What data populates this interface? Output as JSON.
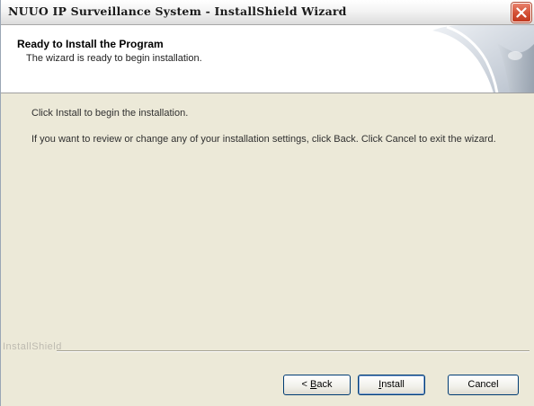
{
  "window": {
    "title": "NUUO IP Surveillance System - InstallShield Wizard"
  },
  "header": {
    "title": "Ready to Install the Program",
    "subtitle": "The wizard is ready to begin installation."
  },
  "body": {
    "line1": "Click Install to begin the installation.",
    "line2": "If you want to review or change any of your installation settings, click Back. Click Cancel to exit the wizard."
  },
  "footer": {
    "brand": "InstallShield",
    "back": {
      "prefix": "< ",
      "mnemonic": "B",
      "rest": "ack"
    },
    "install": {
      "mnemonic": "I",
      "rest": "nstall"
    },
    "cancel": "Cancel"
  },
  "icons": {
    "close": "close-icon",
    "header_graphic": "installshield-header-graphic"
  },
  "colors": {
    "dialog_bg": "#ece9d8",
    "close_button": "#d34f34",
    "button_border": "#003c74",
    "header_bg": "#ffffff"
  }
}
